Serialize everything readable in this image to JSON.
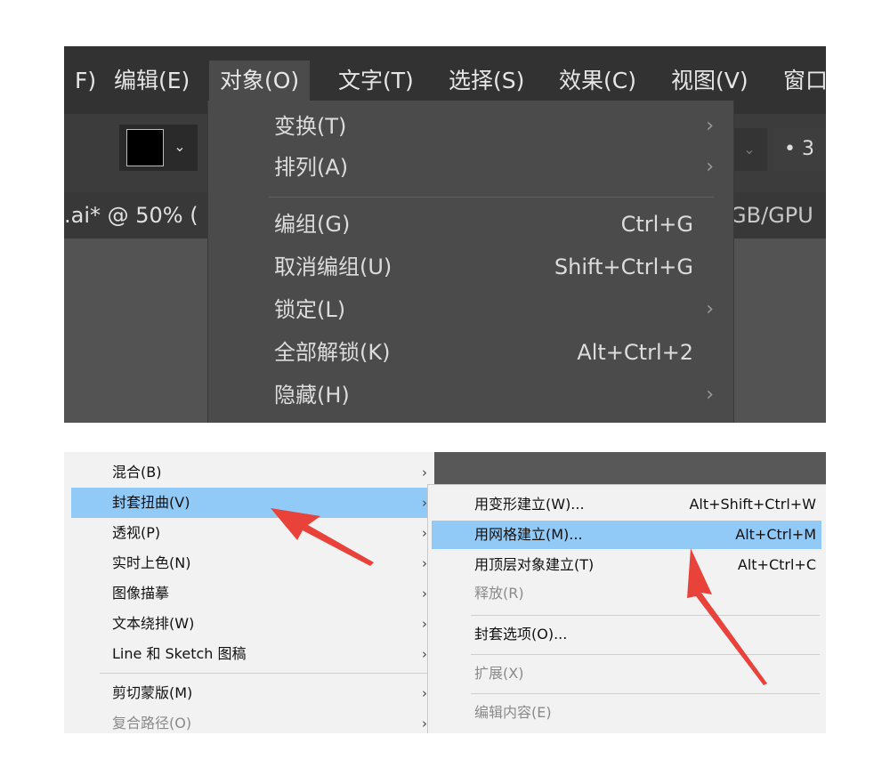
{
  "top": {
    "menubar": [
      {
        "label": "F)"
      },
      {
        "label": "编辑(E)"
      },
      {
        "label": "对象(O)"
      },
      {
        "label": "文字(T)"
      },
      {
        "label": "选择(S)"
      },
      {
        "label": "效果(C)"
      },
      {
        "label": "视图(V)"
      },
      {
        "label": "窗口"
      }
    ],
    "right_control_text": "• 3",
    "doc_tab": ".ai* @ 50% (",
    "doc_mode": "GB/GPU",
    "object_menu": [
      {
        "label": "变换(T)",
        "shortcut": "",
        "submenu": true
      },
      {
        "label": "排列(A)",
        "shortcut": "",
        "submenu": true
      },
      {
        "label": "编组(G)",
        "shortcut": "Ctrl+G",
        "submenu": false
      },
      {
        "label": "取消编组(U)",
        "shortcut": "Shift+Ctrl+G",
        "submenu": false
      },
      {
        "label": "锁定(L)",
        "shortcut": "",
        "submenu": true
      },
      {
        "label": "全部解锁(K)",
        "shortcut": "Alt+Ctrl+2",
        "submenu": false
      },
      {
        "label": "隐藏(H)",
        "shortcut": "",
        "submenu": true
      }
    ],
    "submenu_glyph": "›"
  },
  "bottom": {
    "menu": [
      {
        "label": "混合(B)",
        "state": "normal"
      },
      {
        "label": "封套扭曲(V)",
        "state": "highlighted"
      },
      {
        "label": "透视(P)",
        "state": "normal"
      },
      {
        "label": "实时上色(N)",
        "state": "normal"
      },
      {
        "label": "图像描摹",
        "state": "normal"
      },
      {
        "label": "文本绕排(W)",
        "state": "normal"
      },
      {
        "label": "Line 和 Sketch 图稿",
        "state": "normal"
      },
      {
        "label": "剪切蒙版(M)",
        "state": "normal"
      },
      {
        "label": "复合路径(O)",
        "state": "disabled"
      }
    ],
    "submenu": [
      {
        "label": "用变形建立(W)...",
        "shortcut": "Alt+Shift+Ctrl+W",
        "state": "normal"
      },
      {
        "label": "用网格建立(M)...",
        "shortcut": "Alt+Ctrl+M",
        "state": "highlighted"
      },
      {
        "label": "用顶层对象建立(T)",
        "shortcut": "Alt+Ctrl+C",
        "state": "normal"
      },
      {
        "label": "释放(R)",
        "shortcut": "",
        "state": "disabled"
      },
      {
        "label": "封套选项(O)...",
        "shortcut": "",
        "state": "normal"
      },
      {
        "label": "扩展(X)",
        "shortcut": "",
        "state": "disabled"
      },
      {
        "label": "编辑内容(E)",
        "shortcut": "",
        "state": "disabled"
      }
    ],
    "chevron_glyph": "›"
  },
  "colors": {
    "dark_bg": "#535353",
    "menubar_bg": "#323232",
    "light_menu_bg": "#f2f2f2",
    "highlight": "#91c9f7",
    "arrow_red": "#e8423a"
  }
}
